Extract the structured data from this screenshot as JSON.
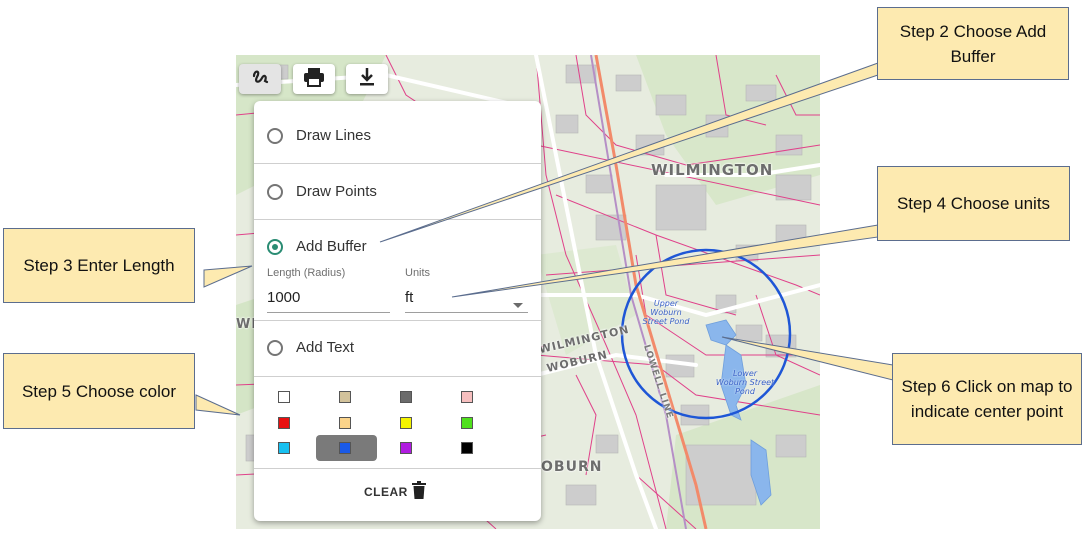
{
  "toolbar": {
    "buttons": [
      {
        "icon": "draw-icon",
        "active": true
      },
      {
        "icon": "print-icon",
        "active": false
      },
      {
        "icon": "download-icon",
        "active": false
      }
    ]
  },
  "map": {
    "labels": {
      "wilmington": "WILMINGTON",
      "wilmington_edge": "WILMINGTON",
      "woburn_road": "WOBURN",
      "woburn": "OBURN",
      "west_edge": "WI",
      "lowell_line": "LOWELL LINE"
    },
    "water": {
      "upper": "Upper\nWoburn\nStreet Pond",
      "lower": "Lower\nWoburn Street\nPond"
    },
    "buffer_color": "#1e56d6"
  },
  "panel": {
    "options": [
      {
        "label": "Draw Lines",
        "checked": false
      },
      {
        "label": "Draw Points",
        "checked": false
      },
      {
        "label": "Add Buffer",
        "checked": true
      },
      {
        "label": "Add Text",
        "checked": false
      }
    ],
    "length_label": "Length (Radius)",
    "length_value": "1000",
    "units_label": "Units",
    "units_value": "ft",
    "colors": [
      "#ffffff",
      "#d2c29b",
      "#6b6b6b",
      "#f7bfbf",
      "#e81010",
      "#fbd48a",
      "#f4f400",
      "#4fe01c",
      "#18c0f0",
      "#1a5ae8",
      "#b01ce0",
      "#000000"
    ],
    "selected_color": "#1a5ae8",
    "clear_label": "CLEAR"
  },
  "callouts": {
    "step2": "Step 2 Choose Add Buffer",
    "step3": "Step 3 Enter Length",
    "step4": "Step 4 Choose units",
    "step5": "Step 5 Choose color",
    "step6": "Step 6 Click on map to indicate center point"
  }
}
